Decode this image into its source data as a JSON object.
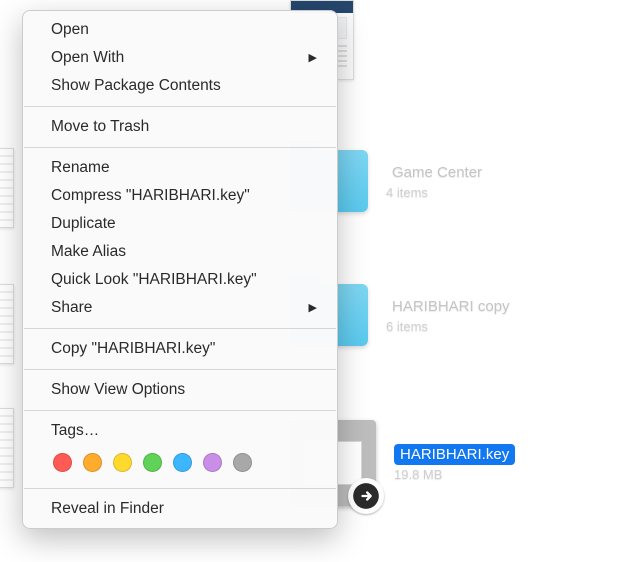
{
  "menu": {
    "open": "Open",
    "open_with": "Open With",
    "show_package": "Show Package Contents",
    "move_to_trash": "Move to Trash",
    "rename": "Rename",
    "compress": "Compress \"HARIBHARI.key\"",
    "duplicate": "Duplicate",
    "make_alias": "Make Alias",
    "quick_look": "Quick Look \"HARIBHARI.key\"",
    "share": "Share",
    "copy": "Copy \"HARIBHARI.key\"",
    "show_view_options": "Show View Options",
    "tags": "Tags…",
    "reveal": "Reveal in Finder"
  },
  "tag_colors": [
    "#ff5b55",
    "#ffab2d",
    "#ffd92e",
    "#60d257",
    "#3cb7ff",
    "#c98fe6",
    "#a8a8a8"
  ],
  "items": {
    "game_center": {
      "name": "Game Center",
      "meta": "4 items"
    },
    "haribhari_copy": {
      "name": "HARIBHARI copy",
      "meta": "6 items"
    },
    "haribhari_key": {
      "name": "HARIBHARI.key",
      "meta": "19.8 MB"
    }
  }
}
